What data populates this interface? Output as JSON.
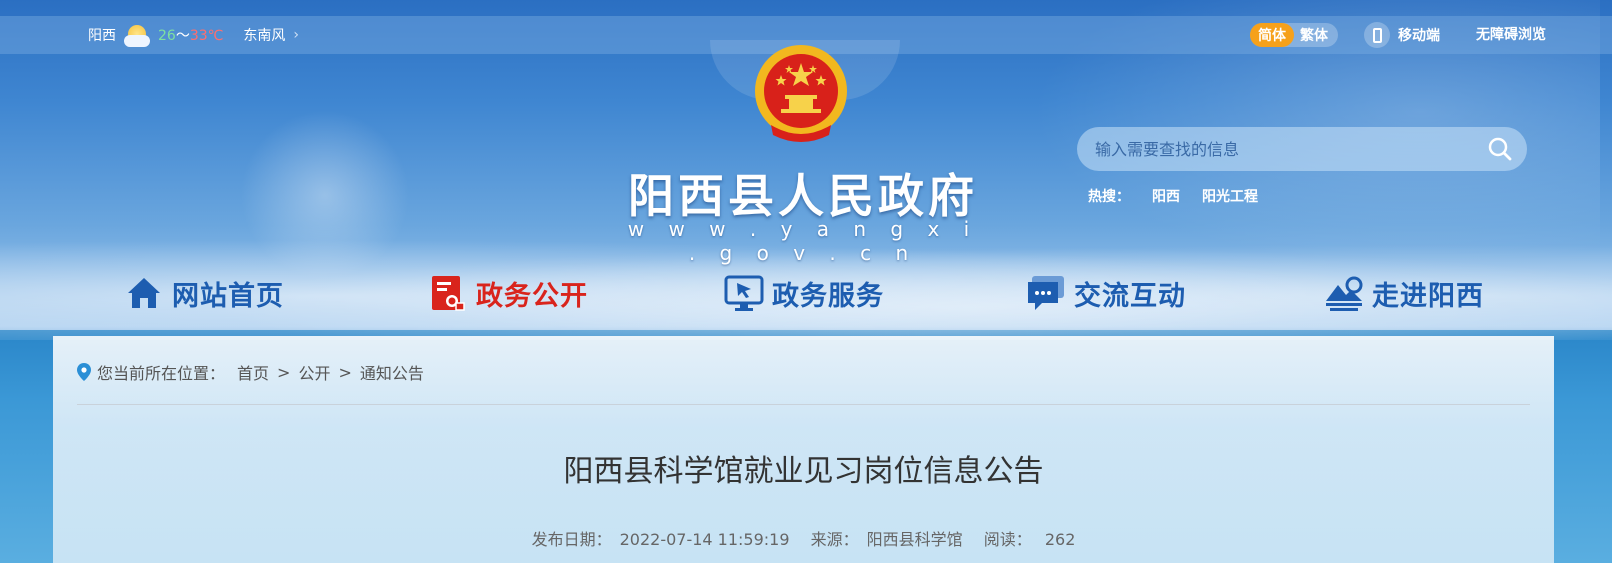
{
  "topbar": {
    "city": "阳西",
    "temp_low": "26",
    "temp_sep": "～",
    "temp_high": "33℃",
    "wind": "东南风",
    "lang_simplified": "简体",
    "lang_traditional": "繁体",
    "mobile_label": "移动端",
    "accessibility_label": "无障碍浏览"
  },
  "header": {
    "site_title": "阳西县人民政府",
    "site_url": "w w w . y a n g x i . g o v . c n"
  },
  "search": {
    "placeholder": "输入需要查找的信息",
    "hot_label": "热搜：",
    "hot_terms": [
      "阳西",
      "阳光工程"
    ]
  },
  "nav": {
    "items": [
      {
        "label": "网站首页",
        "icon": "home-icon"
      },
      {
        "label": "政务公开",
        "icon": "document-icon",
        "active": true
      },
      {
        "label": "政务服务",
        "icon": "service-screen-icon"
      },
      {
        "label": "交流互动",
        "icon": "chat-icon"
      },
      {
        "label": "走进阳西",
        "icon": "landscape-icon"
      }
    ]
  },
  "breadcrumb": {
    "label": "您当前所在位置：",
    "items": [
      "首页",
      "公开",
      "通知公告"
    ],
    "separator": ">"
  },
  "article": {
    "title": "阳西县科学馆就业见习岗位信息公告",
    "date_label": "发布日期：",
    "date": "2022-07-14 11:59:19",
    "source_label": "来源：",
    "source": "阳西县科学馆",
    "views_label": "阅读：",
    "views": "262"
  },
  "colors": {
    "nav_text": "#1d5db0",
    "nav_active": "#d9241c",
    "lang_active_bg": "#f6a11b"
  }
}
